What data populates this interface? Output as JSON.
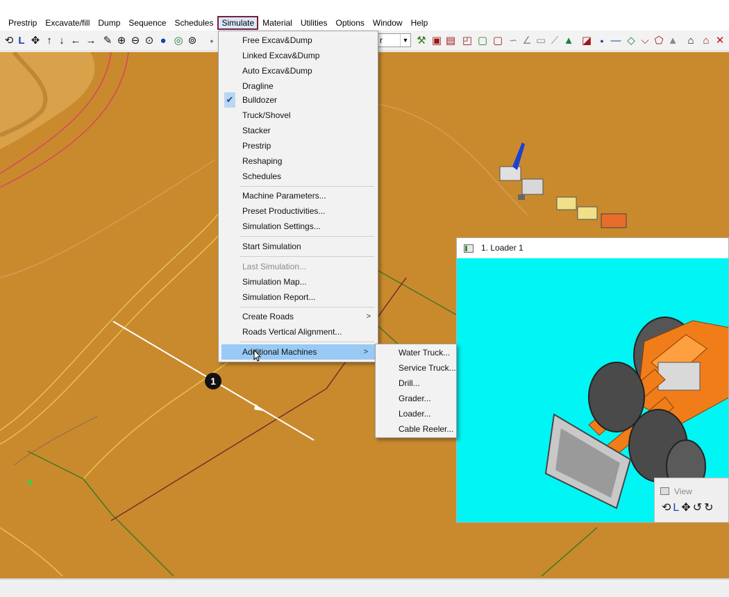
{
  "menubar": {
    "items": [
      "Prestrip",
      "Excavate/fill",
      "Dump",
      "Sequence",
      "Schedules",
      "Simulate",
      "Material",
      "Utilities",
      "Options",
      "Window",
      "Help"
    ],
    "active": "Simulate"
  },
  "toolbar": {
    "combo_value": "r"
  },
  "simulate_menu": {
    "items": [
      "Free Excav&Dump",
      "Linked Excav&Dump",
      "Auto Excav&Dump",
      "Dragline",
      "Bulldozer",
      "Truck/Shovel",
      "Stacker",
      "Prestrip",
      "Reshaping",
      "Schedules",
      "Machine Parameters...",
      "Preset Productivities...",
      "Simulation Settings...",
      "Start Simulation",
      "Last Simulation...",
      "Simulation Map...",
      "Simulation Report...",
      "Create Roads",
      "Roads Vertical Alignment...",
      "Additional Machines"
    ],
    "checked": "Bulldozer",
    "disabled": "Last Simulation...",
    "highlighted": "Additional Machines"
  },
  "additional_machines_menu": {
    "items": [
      "Water Truck...",
      "Service Truck...",
      "Drill...",
      "Grader...",
      "Loader...",
      "Cable Reeler..."
    ]
  },
  "loader_window": {
    "title": "1. Loader 1"
  },
  "view_window": {
    "title": "View"
  },
  "marker": {
    "label": "1"
  },
  "colors": {
    "terrain": "#c98a2e",
    "loader_background": "#00f5f5",
    "loader_body": "#f07d1a",
    "menu_highlight": "#99c9f5",
    "active_menu_border": "#7a1f3d"
  }
}
